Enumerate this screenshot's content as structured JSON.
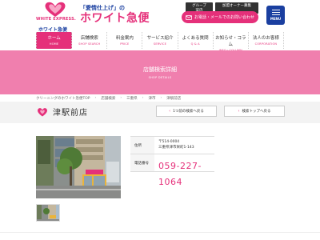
{
  "header": {
    "logo_text": "WHITE EXPRESS.",
    "logo_sub": "ホワイト急便",
    "slogan_top": "「愛情仕上げ」の",
    "slogan_main": "ホワイト急便",
    "toplinks": [
      "グループ案内",
      "加盟オーナー募集"
    ],
    "contact_label": "お電話・メールでのお問い合わせ",
    "menu_label": "MENU"
  },
  "nav": {
    "items": [
      {
        "label": "ホーム",
        "sub": "HOME"
      },
      {
        "label": "店舗検索",
        "sub": "SHOP SEARCH"
      },
      {
        "label": "料金案内",
        "sub": "PRICE"
      },
      {
        "label": "サービス紹介",
        "sub": "SERVICE"
      },
      {
        "label": "よくある質問",
        "sub": "Q & A"
      },
      {
        "label": "お知らせ・コラム",
        "sub": "INFO・COLUMN"
      },
      {
        "label": "法人のお客様",
        "sub": "CORPORATION"
      }
    ]
  },
  "banner": {
    "title": "店舗検索詳細",
    "subtitle": "SHOP DETAILS"
  },
  "breadcrumb": [
    "クリーニングのホワイト急便TOP",
    "店舗検索",
    "三重県",
    "津市",
    "津駅前店"
  ],
  "store": {
    "name": "津駅前店",
    "back_label": "1つ前の検索へ戻る",
    "top_label": "検索トップへ戻る"
  },
  "info": {
    "address_label": "住所",
    "postal": "〒514-0004",
    "address": "三重県津市栄町1-143",
    "tel_label": "電話番号",
    "tel": "059-227-1064"
  },
  "colors": {
    "brand_pink": "#e5307a",
    "banner_pink": "#f07fae",
    "brand_blue": "#1a3fa0"
  }
}
